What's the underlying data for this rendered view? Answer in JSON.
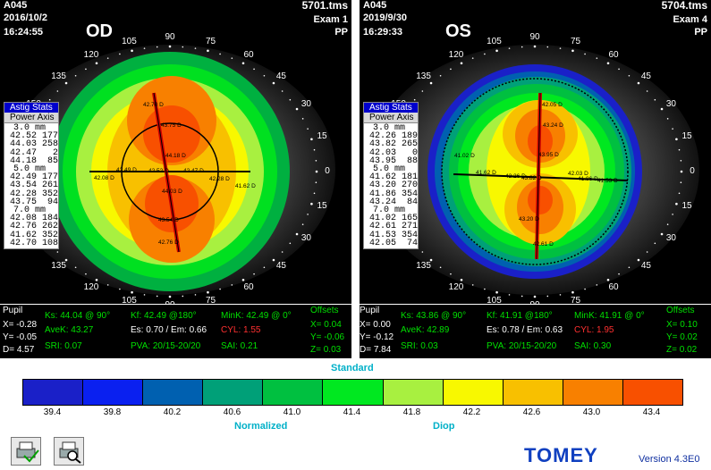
{
  "colors": {
    "scale": [
      "#1a20c8",
      "#0a20f0",
      "#0060b0",
      "#00a078",
      "#00c040",
      "#00e820",
      "#a8f040",
      "#f8f800",
      "#f8c000",
      "#f88000",
      "#f85000"
    ]
  },
  "scale": {
    "title": "Standard",
    "ticks": [
      "39.4",
      "39.8",
      "40.2",
      "40.6",
      "41.0",
      "41.4",
      "41.8",
      "42.2",
      "42.6",
      "43.0",
      "43.4"
    ],
    "normalized_label": "Normalized",
    "diop_label": "Diop"
  },
  "od": {
    "id": "A045",
    "file": "5701.tms",
    "date": "2016/10/2",
    "exam": "Exam 1",
    "time": "16:24:55",
    "pp": "PP",
    "eye": "OD",
    "angles": [
      "90",
      "105",
      "75",
      "120",
      "60",
      "135",
      "45",
      "150",
      "30",
      "165",
      "15",
      "0",
      "15",
      "30",
      "45",
      "60",
      "75",
      "90",
      "105",
      "120",
      "135",
      "150",
      "165"
    ],
    "astig": {
      "stats_label": "Astig Stats",
      "power_axis_label": "Power Axis",
      "g1": {
        "title": "3.0 mm",
        "rows": [
          "42.52 177",
          "44.03 258",
          "42.47   2",
          "44.18  85"
        ]
      },
      "g2": {
        "title": "5.0 mm",
        "rows": [
          "42.49 177",
          "43.54 261",
          "42.28 352",
          "43.75  94"
        ]
      },
      "g3": {
        "title": "7.0 mm",
        "rows": [
          "42.08 184",
          "42.76 262",
          "41.62 352",
          "42.70 108"
        ]
      }
    },
    "map_labels": [
      "42.70 D",
      "43.75 D",
      "44.18 D",
      "42.49 D",
      "42.52 D",
      "42.47 D",
      "42.08 D",
      "42.28 D",
      "41.62 D",
      "44.03 D",
      "43.54 D",
      "42.76 D"
    ],
    "info": {
      "pupil": "Pupil",
      "x": "X= -0.28",
      "y": "Y= -0.05",
      "d": "D=  4.57",
      "ks": "Ks: 44.04 @ 90°",
      "avek": "AveK: 43.27",
      "sri": "SRI: 0.07",
      "kf": "Kf: 42.49 @180°",
      "es": "Es: 0.70 / Em: 0.66",
      "pva": "PVA: 20/15-20/20",
      "mink": "MinK: 42.49 @  0°",
      "cyl": "CYL:  1.55",
      "sai": "SAI: 0.21",
      "offsets": "Offsets",
      "ox": "X=  0.04",
      "oy": "Y= -0.06",
      "oz": "Z=  0.03"
    }
  },
  "os": {
    "id": "A045",
    "file": "5704.tms",
    "date": "2019/9/30",
    "exam": "Exam 4",
    "time": "16:29:33",
    "pp": "PP",
    "eye": "OS",
    "angles": [
      "90",
      "105",
      "75",
      "120",
      "60",
      "135",
      "45",
      "150",
      "30",
      "165",
      "15",
      "0",
      "15",
      "30",
      "45",
      "60",
      "75",
      "90",
      "105",
      "120",
      "135",
      "150",
      "165"
    ],
    "astig": {
      "stats_label": "Astig Stats",
      "power_axis_label": "Power Axis",
      "g1": {
        "title": "3.0 mm",
        "rows": [
          "42.26 189",
          "43.82 265",
          "42.03   0",
          "43.95  88"
        ]
      },
      "g2": {
        "title": "5.0 mm",
        "rows": [
          "41.62 181",
          "43.20 270",
          "41.86 354",
          "43.24  84"
        ]
      },
      "g3": {
        "title": "7.0 mm",
        "rows": [
          "41.02 165",
          "42.61 271",
          "41.53 354",
          "42.05  74"
        ]
      }
    },
    "map_labels": [
      "42.05 D",
      "43.24 D",
      "43.95 D",
      "41.02 D",
      "41.62 D",
      "42.26 D",
      "42.03 D",
      "41.86 D",
      "41.53 D",
      "43.82 D",
      "43.20 D",
      "42.61 D"
    ],
    "info": {
      "pupil": "Pupil",
      "x": "X=  0.00",
      "y": "Y= -0.12",
      "d": "D=  7.84",
      "ks": "Ks: 43.86 @ 90°",
      "avek": "AveK: 42.89",
      "sri": "SRI: 0.03",
      "kf": "Kf: 41.91 @180°",
      "es": "Es: 0.78 / Em: 0.63",
      "pva": "PVA: 20/15-20/20",
      "mink": "MinK: 41.91 @  0°",
      "cyl": "CYL:  1.95",
      "sai": "SAI: 0.30",
      "offsets": "Offsets",
      "ox": "X=  0.10",
      "oy": "Y=  0.02",
      "oz": "Z=  0.02"
    }
  },
  "footer": {
    "logo": "TOMEY",
    "version": "Version 4.3E0"
  }
}
